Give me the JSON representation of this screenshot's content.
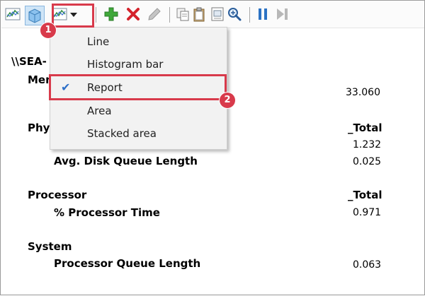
{
  "menu": {
    "items": [
      {
        "label": "Line",
        "checked": false
      },
      {
        "label": "Histogram bar",
        "checked": false
      },
      {
        "label": "Report",
        "checked": true
      },
      {
        "label": "Area",
        "checked": false
      },
      {
        "label": "Stacked area",
        "checked": false
      }
    ]
  },
  "report": {
    "computer": "\\\\SEA-",
    "object_memory": "Mem",
    "memory_value": "33.060",
    "object_physicaldisk": "Phys",
    "physicaldisk_instance": "_Total",
    "physicaldisk_value_1": "1.232",
    "physicaldisk_counter_2": "Avg. Disk Queue Length",
    "physicaldisk_value_2": "0.025",
    "object_processor": "Processor",
    "processor_instance": "_Total",
    "processor_counter": "% Processor Time",
    "processor_value": "0.971",
    "object_system": "System",
    "system_counter": "Processor Queue Length",
    "system_value": "0.063"
  },
  "annotations": {
    "step1": "1",
    "step2": "2"
  },
  "colors": {
    "annotation": "#d83a4b",
    "accent": "#2d6fc8"
  }
}
